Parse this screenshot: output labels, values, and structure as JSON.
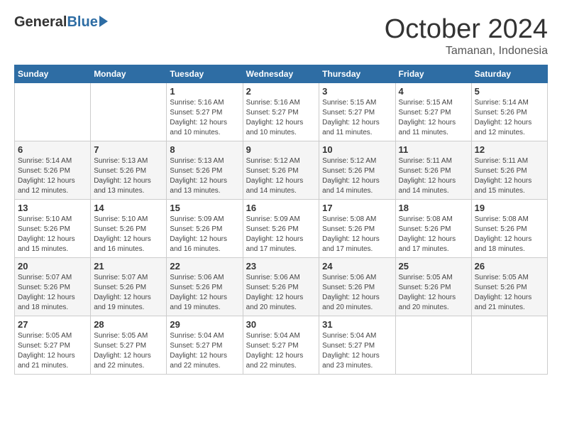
{
  "header": {
    "logo_general": "General",
    "logo_blue": "Blue",
    "month_title": "October 2024",
    "location": "Tamanan, Indonesia"
  },
  "weekdays": [
    "Sunday",
    "Monday",
    "Tuesday",
    "Wednesday",
    "Thursday",
    "Friday",
    "Saturday"
  ],
  "weeks": [
    [
      {
        "day": "",
        "info": ""
      },
      {
        "day": "",
        "info": ""
      },
      {
        "day": "1",
        "info": "Sunrise: 5:16 AM\nSunset: 5:27 PM\nDaylight: 12 hours\nand 10 minutes."
      },
      {
        "day": "2",
        "info": "Sunrise: 5:16 AM\nSunset: 5:27 PM\nDaylight: 12 hours\nand 10 minutes."
      },
      {
        "day": "3",
        "info": "Sunrise: 5:15 AM\nSunset: 5:27 PM\nDaylight: 12 hours\nand 11 minutes."
      },
      {
        "day": "4",
        "info": "Sunrise: 5:15 AM\nSunset: 5:27 PM\nDaylight: 12 hours\nand 11 minutes."
      },
      {
        "day": "5",
        "info": "Sunrise: 5:14 AM\nSunset: 5:26 PM\nDaylight: 12 hours\nand 12 minutes."
      }
    ],
    [
      {
        "day": "6",
        "info": "Sunrise: 5:14 AM\nSunset: 5:26 PM\nDaylight: 12 hours\nand 12 minutes."
      },
      {
        "day": "7",
        "info": "Sunrise: 5:13 AM\nSunset: 5:26 PM\nDaylight: 12 hours\nand 13 minutes."
      },
      {
        "day": "8",
        "info": "Sunrise: 5:13 AM\nSunset: 5:26 PM\nDaylight: 12 hours\nand 13 minutes."
      },
      {
        "day": "9",
        "info": "Sunrise: 5:12 AM\nSunset: 5:26 PM\nDaylight: 12 hours\nand 14 minutes."
      },
      {
        "day": "10",
        "info": "Sunrise: 5:12 AM\nSunset: 5:26 PM\nDaylight: 12 hours\nand 14 minutes."
      },
      {
        "day": "11",
        "info": "Sunrise: 5:11 AM\nSunset: 5:26 PM\nDaylight: 12 hours\nand 14 minutes."
      },
      {
        "day": "12",
        "info": "Sunrise: 5:11 AM\nSunset: 5:26 PM\nDaylight: 12 hours\nand 15 minutes."
      }
    ],
    [
      {
        "day": "13",
        "info": "Sunrise: 5:10 AM\nSunset: 5:26 PM\nDaylight: 12 hours\nand 15 minutes."
      },
      {
        "day": "14",
        "info": "Sunrise: 5:10 AM\nSunset: 5:26 PM\nDaylight: 12 hours\nand 16 minutes."
      },
      {
        "day": "15",
        "info": "Sunrise: 5:09 AM\nSunset: 5:26 PM\nDaylight: 12 hours\nand 16 minutes."
      },
      {
        "day": "16",
        "info": "Sunrise: 5:09 AM\nSunset: 5:26 PM\nDaylight: 12 hours\nand 17 minutes."
      },
      {
        "day": "17",
        "info": "Sunrise: 5:08 AM\nSunset: 5:26 PM\nDaylight: 12 hours\nand 17 minutes."
      },
      {
        "day": "18",
        "info": "Sunrise: 5:08 AM\nSunset: 5:26 PM\nDaylight: 12 hours\nand 17 minutes."
      },
      {
        "day": "19",
        "info": "Sunrise: 5:08 AM\nSunset: 5:26 PM\nDaylight: 12 hours\nand 18 minutes."
      }
    ],
    [
      {
        "day": "20",
        "info": "Sunrise: 5:07 AM\nSunset: 5:26 PM\nDaylight: 12 hours\nand 18 minutes."
      },
      {
        "day": "21",
        "info": "Sunrise: 5:07 AM\nSunset: 5:26 PM\nDaylight: 12 hours\nand 19 minutes."
      },
      {
        "day": "22",
        "info": "Sunrise: 5:06 AM\nSunset: 5:26 PM\nDaylight: 12 hours\nand 19 minutes."
      },
      {
        "day": "23",
        "info": "Sunrise: 5:06 AM\nSunset: 5:26 PM\nDaylight: 12 hours\nand 20 minutes."
      },
      {
        "day": "24",
        "info": "Sunrise: 5:06 AM\nSunset: 5:26 PM\nDaylight: 12 hours\nand 20 minutes."
      },
      {
        "day": "25",
        "info": "Sunrise: 5:05 AM\nSunset: 5:26 PM\nDaylight: 12 hours\nand 20 minutes."
      },
      {
        "day": "26",
        "info": "Sunrise: 5:05 AM\nSunset: 5:26 PM\nDaylight: 12 hours\nand 21 minutes."
      }
    ],
    [
      {
        "day": "27",
        "info": "Sunrise: 5:05 AM\nSunset: 5:27 PM\nDaylight: 12 hours\nand 21 minutes."
      },
      {
        "day": "28",
        "info": "Sunrise: 5:05 AM\nSunset: 5:27 PM\nDaylight: 12 hours\nand 22 minutes."
      },
      {
        "day": "29",
        "info": "Sunrise: 5:04 AM\nSunset: 5:27 PM\nDaylight: 12 hours\nand 22 minutes."
      },
      {
        "day": "30",
        "info": "Sunrise: 5:04 AM\nSunset: 5:27 PM\nDaylight: 12 hours\nand 22 minutes."
      },
      {
        "day": "31",
        "info": "Sunrise: 5:04 AM\nSunset: 5:27 PM\nDaylight: 12 hours\nand 23 minutes."
      },
      {
        "day": "",
        "info": ""
      },
      {
        "day": "",
        "info": ""
      }
    ]
  ]
}
